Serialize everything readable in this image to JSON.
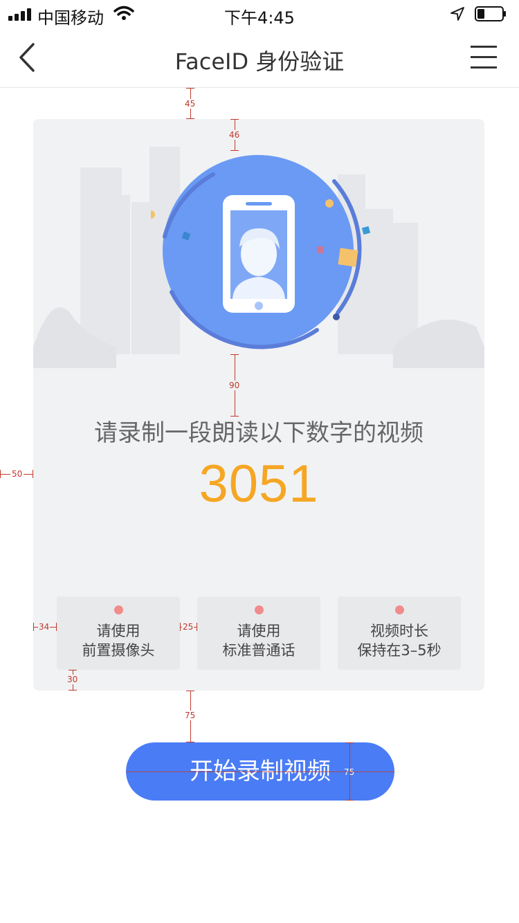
{
  "status_bar": {
    "carrier": "中国移动",
    "time": "下午4:45"
  },
  "nav": {
    "title": "FaceID 身份验证"
  },
  "card": {
    "prompt": "请录制一段朗读以下数字的视频",
    "code": "3051",
    "tips": [
      {
        "line1": "请使用",
        "line2": "前置摄像头"
      },
      {
        "line1": "请使用",
        "line2": "标准普通话"
      },
      {
        "line1": "视频时长",
        "line2": "保持在3–5秒"
      }
    ]
  },
  "start_button": {
    "label": "开始录制视频"
  },
  "annotations": {
    "a45": "45",
    "a46": "46",
    "a90": "90",
    "a50": "50",
    "a34": "34",
    "a25": "25",
    "a30": "30",
    "a75_gap": "75",
    "a75_height": "75"
  },
  "colors": {
    "accent": "#4a7cf6",
    "code": "#f5a623",
    "tip_dot": "#f08c8c",
    "annotation": "#c0392b"
  }
}
